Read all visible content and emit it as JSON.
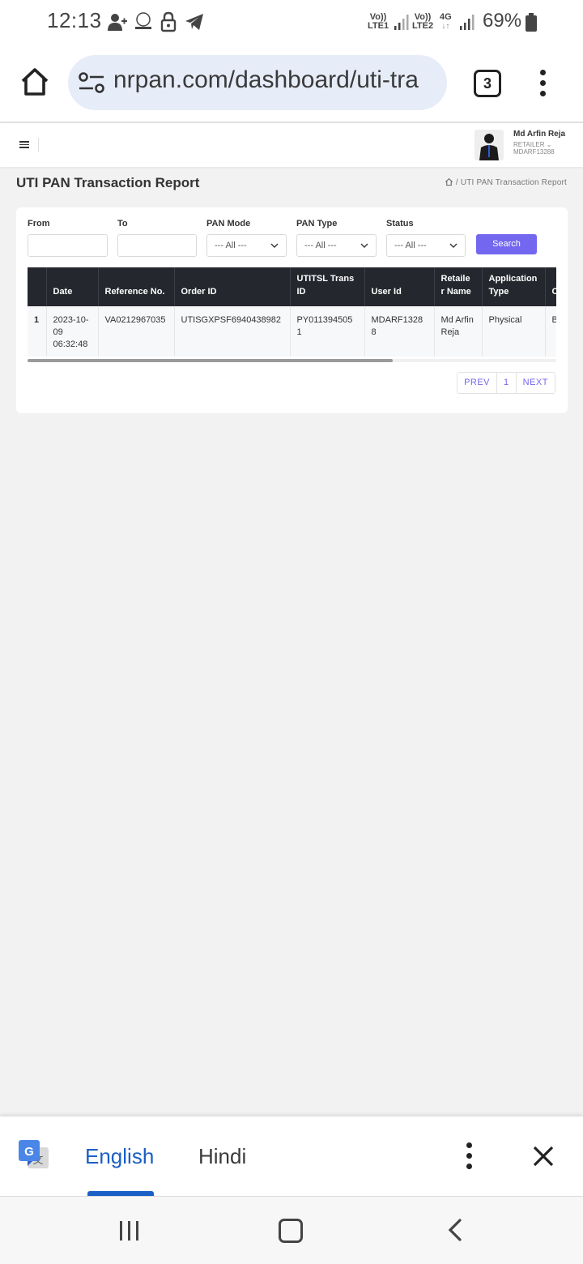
{
  "status_bar": {
    "time": "12:13",
    "sim1_line1": "Vo))",
    "sim1_line2": "LTE1",
    "sim2_line1": "Vo))",
    "sim2_line2": "LTE2",
    "net_type": "4G",
    "battery": "69%"
  },
  "browser": {
    "url": "nrpan.com/dashboard/uti-tra",
    "tab_count": "3"
  },
  "header": {
    "user_name": "Md Arfin Reja",
    "user_role": "RETAILER",
    "user_id": "MDARF13288"
  },
  "page": {
    "title": "UTI PAN Transaction Report",
    "breadcrumb_current": "UTI PAN Transaction Report"
  },
  "filters": {
    "from_label": "From",
    "to_label": "To",
    "pan_mode_label": "PAN Mode",
    "pan_mode_value": "--- All ---",
    "pan_type_label": "PAN Type",
    "pan_type_value": "--- All ---",
    "status_label": "Status",
    "status_value": "--- All ---",
    "search_label": "Search"
  },
  "table": {
    "headers": [
      "",
      "Date",
      "Reference No.",
      "Order ID",
      "UTITSL Trans ID",
      "User Id",
      "Retaile r Name",
      "Application Type",
      "C"
    ],
    "rows": [
      [
        "1",
        "2023-10-09 06:32:48",
        "VA0212967035",
        "UTISGXPSF6940438982",
        "PY0113945051",
        "MDARF13288",
        "Md Arfin Reja",
        "Physical",
        "B"
      ]
    ]
  },
  "pagination": {
    "prev": "PREV",
    "page": "1",
    "next": "NEXT"
  },
  "translate_bar": {
    "source_language": "English",
    "target_language": "Hindi"
  }
}
